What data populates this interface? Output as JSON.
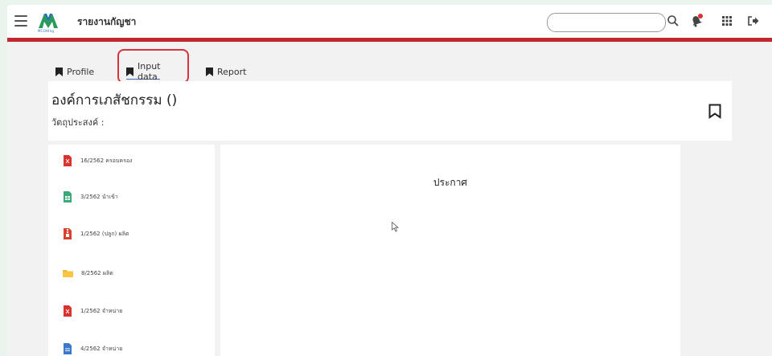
{
  "header": {
    "app_title": "รายงานกัญชา",
    "logo_text": "MCOHIng",
    "search": {
      "value": "",
      "placeholder": ""
    },
    "icons": [
      "menu-icon",
      "search-icon",
      "bell-icon",
      "apps-grid-icon",
      "logout-icon"
    ],
    "accent_color": "#c0282d"
  },
  "tabs": [
    {
      "label": "Profile",
      "icon": "bookmark-icon"
    },
    {
      "label": "Input data",
      "icon": "bookmark-icon",
      "active": true
    },
    {
      "label": "Report",
      "icon": "bookmark-icon"
    }
  ],
  "org": {
    "title": "องค์การเภสัชกรรม ()",
    "objective_label": "วัตถุประสงค์ :"
  },
  "files": [
    {
      "label": "16/2562 ครอบครอง",
      "icon": "pdf-file-icon"
    },
    {
      "label": "3/2562 นำเข้า",
      "icon": "sheet-file-icon"
    },
    {
      "label": "1/2562 (ปลูก) ผลิต",
      "icon": "zip-file-icon"
    },
    {
      "label": "8/2562 ผลิต",
      "icon": "folder-icon"
    },
    {
      "label": "1/2562 จำหน่าย",
      "icon": "pdf-file-icon"
    },
    {
      "label": "4/2562 จำหน่าย",
      "icon": "doc-file-icon"
    }
  ],
  "main": {
    "heading": "ประกาศ"
  }
}
